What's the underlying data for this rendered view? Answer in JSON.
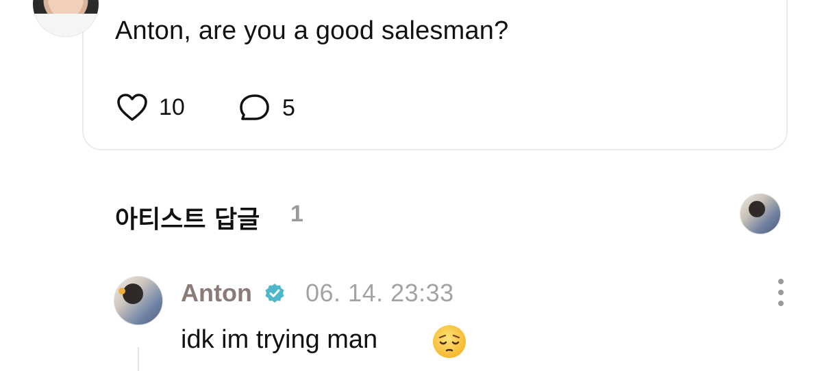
{
  "post": {
    "text": "Anton, are you a good salesman?",
    "likes": "10",
    "comments": "5"
  },
  "artist_replies": {
    "title": "아티스트 답글",
    "count": "1"
  },
  "comment": {
    "author": "Anton",
    "timestamp": "06. 14. 23:33",
    "text": "idk im trying man",
    "emoji": "pensive-face-icon"
  },
  "colors": {
    "verified": "#4db8c9",
    "author": "#8a7b76",
    "muted": "#a3a3a3",
    "border": "#ebebeb"
  }
}
